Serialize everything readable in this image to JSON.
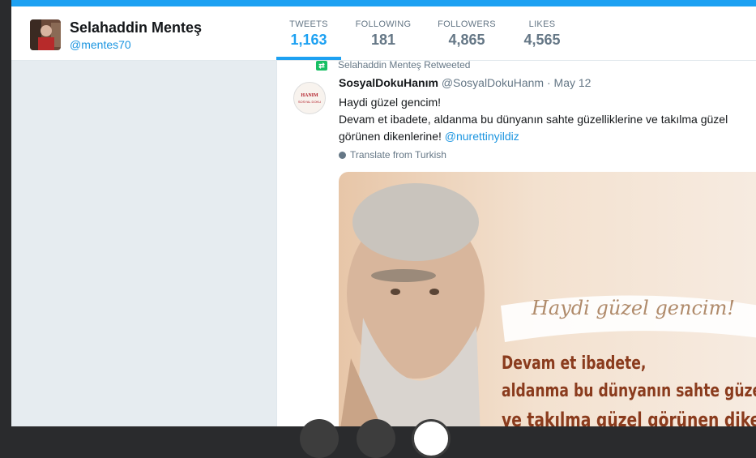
{
  "profile": {
    "name": "Selahaddin Menteş",
    "handle": "@mentes70"
  },
  "stats": [
    {
      "label": "TWEETS",
      "value": "1,163"
    },
    {
      "label": "FOLLOWING",
      "value": "181"
    },
    {
      "label": "FOLLOWERS",
      "value": "4,865"
    },
    {
      "label": "LIKES",
      "value": "4,565"
    }
  ],
  "tweet": {
    "retweet_label": "Selahaddin Menteş Retweeted",
    "author": "SosyalDokuHanım",
    "handle": "@SosyalDokuHanm",
    "separator": "·",
    "date": "May 12",
    "lines": [
      "Haydi güzel gencim!",
      "Devam et ibadete, aldanma bu dünyanın sahte güzelliklerine ve takılma güzel",
      "görünen dikenlerine!"
    ],
    "mention": "@nurettinyildiz",
    "translate_label": "Translate from Turkish",
    "avatar_brand": "HANIM",
    "avatar_brand_sub": "SOSYAL DOKU",
    "media": {
      "banner": "Haydi güzel gencim!",
      "lines": [
        "Devam et ibadete,",
        "aldanma bu dünyanın sahte güzelliklerine",
        "ve takılma güzel görünen dikenlerine!"
      ]
    }
  },
  "colors": {
    "accent": "#1da1f2",
    "link": "#1b95e0",
    "retweet": "#17bf63",
    "muted": "#657786"
  },
  "icons": {
    "retweet": "retweet-icon",
    "globe": "globe-icon"
  }
}
